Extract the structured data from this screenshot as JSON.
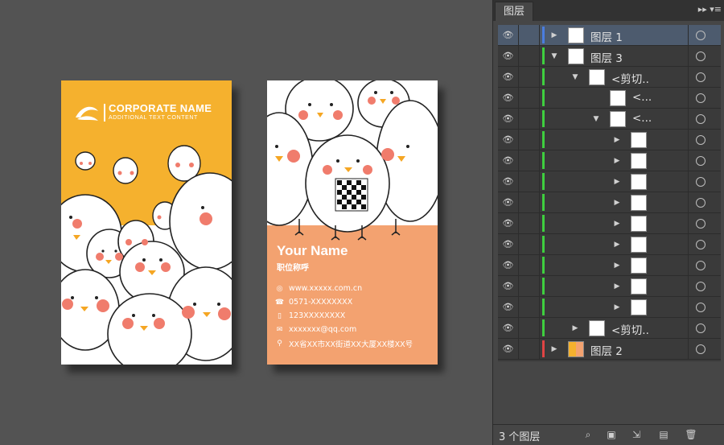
{
  "front_card": {
    "company_name": "CORPORATE NAME",
    "tagline": "ADDITIONAL TEXT CONTENT",
    "background_color": "#f5b12e"
  },
  "back_card": {
    "name": "Your Name",
    "job_title": "职位称呼",
    "background_color": "#f3a270",
    "contacts": [
      {
        "icon": "dribbble-icon",
        "text": "www.xxxxx.com.cn"
      },
      {
        "icon": "phone-icon",
        "text": "0571-XXXXXXXX"
      },
      {
        "icon": "mobile-icon",
        "text": "123XXXXXXXX"
      },
      {
        "icon": "mail-icon",
        "text": "xxxxxxx@qq.com"
      },
      {
        "icon": "location-icon",
        "text": "XX省XX市XX街道XX大厦XX楼XX号"
      }
    ]
  },
  "layers_panel": {
    "tab_label": "图层",
    "footer_count": "3 个图层",
    "rows": [
      {
        "name": "图层 1",
        "selected": true,
        "color": "#4a7de0",
        "expanded": false,
        "level": 0
      },
      {
        "name": "图层 3",
        "selected": false,
        "color": "#3fcf3f",
        "expanded": true,
        "level": 0
      },
      {
        "name": "<剪切..",
        "selected": false,
        "color": "#3fcf3f",
        "expanded": true,
        "level": 1
      },
      {
        "name": "<...",
        "selected": false,
        "color": "#3fcf3f",
        "expanded": false,
        "level": 2,
        "no_arrow": true
      },
      {
        "name": "<...",
        "selected": false,
        "color": "#3fcf3f",
        "expanded": true,
        "level": 2
      },
      {
        "name": "",
        "selected": false,
        "color": "#3fcf3f",
        "expanded": false,
        "level": 3
      },
      {
        "name": "",
        "selected": false,
        "color": "#3fcf3f",
        "expanded": false,
        "level": 3
      },
      {
        "name": "",
        "selected": false,
        "color": "#3fcf3f",
        "expanded": false,
        "level": 3
      },
      {
        "name": "",
        "selected": false,
        "color": "#3fcf3f",
        "expanded": false,
        "level": 3
      },
      {
        "name": "",
        "selected": false,
        "color": "#3fcf3f",
        "expanded": false,
        "level": 3
      },
      {
        "name": "",
        "selected": false,
        "color": "#3fcf3f",
        "expanded": false,
        "level": 3
      },
      {
        "name": "",
        "selected": false,
        "color": "#3fcf3f",
        "expanded": false,
        "level": 3
      },
      {
        "name": "",
        "selected": false,
        "color": "#3fcf3f",
        "expanded": false,
        "level": 3
      },
      {
        "name": "",
        "selected": false,
        "color": "#3fcf3f",
        "expanded": false,
        "level": 3
      },
      {
        "name": "<剪切..",
        "selected": false,
        "color": "#3fcf3f",
        "expanded": false,
        "level": 1
      },
      {
        "name": "图层 2",
        "selected": false,
        "color": "#e04444",
        "expanded": false,
        "level": 0
      }
    ]
  }
}
